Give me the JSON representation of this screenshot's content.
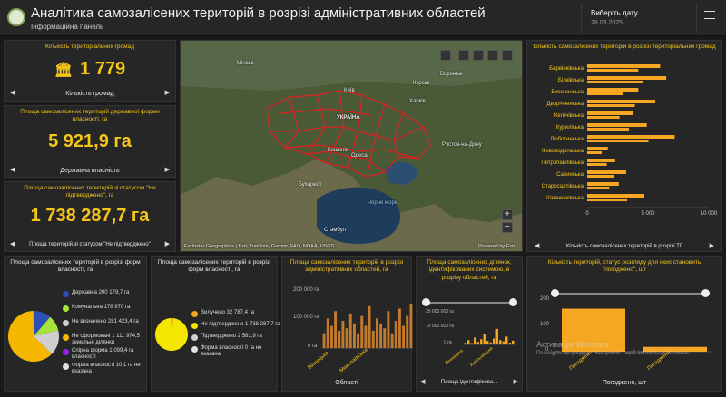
{
  "header": {
    "title": "Аналітика самозалісених територій в розрізі адміністративних областей",
    "subtitle": "Інформаційна панель",
    "date_label": "Виберіть дату",
    "date_value": "28.03.2025"
  },
  "kpis": [
    {
      "title": "Кількість територіальних громад",
      "value": "1 779",
      "caption": "Кількість громад"
    },
    {
      "title": "Площа самозалісених територій державної форми власності, га",
      "value": "5 921,9 га",
      "caption": "Державна власність"
    },
    {
      "title": "Площа самозалісених територій зі статусом \"Не підтверджено\", га",
      "value": "1 738 287,7 га",
      "caption": "Площа територій зі статусом \"Не підтверджено\""
    }
  ],
  "map": {
    "labels": [
      "Мінськ",
      "Київ",
      "Харків",
      "УКРАЇНА",
      "Ростов-на-Дону",
      "Одеса",
      "Чорне море",
      "Стамбул",
      "Воронеж",
      "Курськ",
      "Бухарест",
      "Кишинів"
    ],
    "attribution": "Earthstar Geographics | Esri, TomTom, Garmin, FAO, NOAA, USGS",
    "powered": "Powered by Esri"
  },
  "bar_chart_panel": {
    "title": "Кількість самозалісених територій в розрізі територіальних громад",
    "caption": "Кількість самозалісених територій в розрізі ТГ",
    "x_ticks": [
      "0",
      "5 000",
      "10 000"
    ]
  },
  "ownership": {
    "title": "Площа самозалісених територій в розрізі форм власності, га",
    "items": [
      {
        "label": "Державна 200 179,7 га",
        "color": "#2e4fb7"
      },
      {
        "label": "Комунальна 178 970 га",
        "color": "#a6e23a"
      },
      {
        "label": "Не визначено 281 423,4 га",
        "color": "#cfcfcf"
      },
      {
        "label": "Не сформовані 1 111 974,5 земельні ділянки",
        "color": "#f5b700"
      },
      {
        "label": "Спірна форма 1 099,4 га власності",
        "color": "#8a2be2"
      },
      {
        "label": "Форма власності 10,1 га не вказана",
        "color": "#e0e0e0"
      }
    ]
  },
  "status": {
    "title": "Площа самозалісених територій в розрізі форм власності, га",
    "items": [
      {
        "label": "Вилучено 32 787,4 га",
        "color": "#f5a623"
      },
      {
        "label": "Не підтверджено 1 738 287,7 га",
        "color": "#f5e600"
      },
      {
        "label": "Підтверджено 2 581,9 га",
        "color": "#d0d0d0"
      },
      {
        "label": "Форма власності 0 га не вказана",
        "color": "#e0e0e0"
      }
    ]
  },
  "oblast_chart": {
    "title": "Площа самозалісених територій в розрізі адміністративних областей, га",
    "y_ticks": [
      "200 000 га",
      "100 000 га",
      "0 га"
    ],
    "x_labels": [
      "Вінницька",
      "Миколаївська"
    ],
    "caption": "Області"
  },
  "identified_chart": {
    "title": "Площа самозалісених ділянок, ідентифікованих системою, в розрізу областей, га",
    "y_ticks": [
      "20 000 000 га",
      "10 000 000 га",
      "0 га"
    ],
    "x_labels": [
      "Вінницька",
      "Хмельницька"
    ],
    "caption": "Площа ідентифікова..."
  },
  "agreed_chart": {
    "title": "Кількість територій, статус розгляду для яких становить \"погоджено\", шт",
    "y_ticks": [
      "200",
      "100",
      "0"
    ],
    "x_labels": [
      "Погоджено",
      "Погоджено"
    ],
    "caption": "Погоджено, шт"
  },
  "watermark": {
    "line1": "Активація Windows",
    "line2": "Перейдіть до розділу \"Настройки\", щоб активувати Windows."
  },
  "chart_data": [
    {
      "type": "bar",
      "orientation": "horizontal",
      "categories": [
        "Барвінківська",
        "Білківська",
        "Височанська",
        "Дворічненська",
        "Кегичівська",
        "Куриліська",
        "Люботинська",
        "Нововодолазька",
        "Петропавлівська",
        "Савинська",
        "Старосалтівська",
        "Шевченківська"
      ],
      "values": [
        6000,
        6500,
        4200,
        5600,
        3800,
        4900,
        7200,
        1700,
        2300,
        3200,
        2600,
        4700
      ],
      "xlim": [
        0,
        10000
      ],
      "xlabel": "Кількість самозалісених територій в розрізі ТГ"
    },
    {
      "type": "pie",
      "categories": [
        "Державна",
        "Комунальна",
        "Не визначено",
        "Не сформовані земельні ділянки",
        "Спірна форма власності",
        "Форма власності не вказана"
      ],
      "values": [
        200179.7,
        178970,
        281423.4,
        1111974.5,
        1099.4,
        10.1
      ]
    },
    {
      "type": "pie",
      "categories": [
        "Вилучено",
        "Не підтверджено",
        "Підтверджено",
        "Форма власності не вказана"
      ],
      "values": [
        32787.4,
        1738287.7,
        2581.9,
        0
      ]
    },
    {
      "type": "bar",
      "values": [
        60000,
        120000,
        90000,
        150000,
        70000,
        110000,
        80000,
        140000,
        100000,
        60000,
        130000,
        90000,
        170000,
        70000,
        120000,
        100000,
        80000,
        150000,
        60000,
        110000,
        160000,
        90000,
        130000,
        180000
      ],
      "ylim": [
        0,
        250000
      ],
      "xlabel": "Області"
    },
    {
      "type": "bar",
      "values": [
        1000000,
        2500000,
        800000,
        4000000,
        1500000,
        3000000,
        6000000,
        2000000,
        1200000,
        3500000,
        9000000,
        2500000,
        1800000,
        4500000,
        1000000,
        2200000
      ],
      "ylim": [
        0,
        20000000
      ],
      "xlabel": "Площа ідентифікова..."
    },
    {
      "type": "bar",
      "categories": [
        "Погоджено",
        "Погоджено"
      ],
      "values": [
        180,
        20
      ],
      "ylim": [
        0,
        220
      ],
      "xlabel": "Погоджено, шт"
    }
  ]
}
